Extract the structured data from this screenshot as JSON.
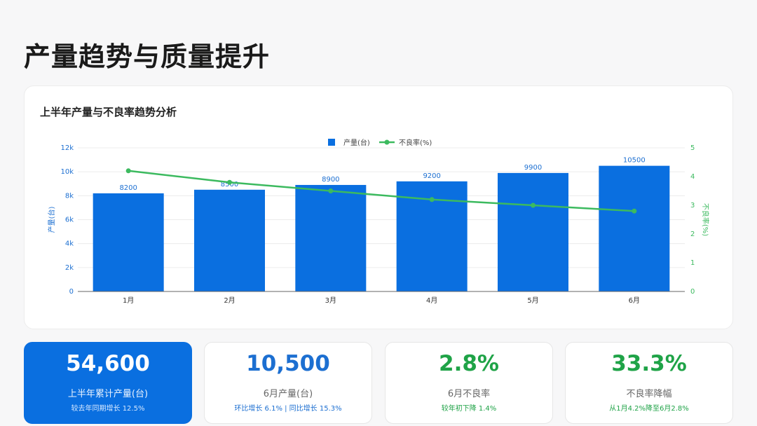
{
  "page_title": "产量趋势与质量提升",
  "chart_title": "上半年产量与不良率趋势分析",
  "chart_data": {
    "type": "bar",
    "categories": [
      "1月",
      "2月",
      "3月",
      "4月",
      "5月",
      "6月"
    ],
    "series": [
      {
        "name": "产量(台)",
        "type": "bar",
        "axis": "left",
        "values": [
          8200,
          8500,
          8900,
          9200,
          9900,
          10500
        ],
        "color": "#0a6fe0"
      },
      {
        "name": "不良率(%)",
        "type": "line",
        "axis": "right",
        "values": [
          4.2,
          3.8,
          3.5,
          3.2,
          3.0,
          2.8
        ],
        "color": "#3cba5f"
      }
    ],
    "bar_labels": [
      "8200",
      "8500",
      "8900",
      "9200",
      "9900",
      "10500"
    ],
    "ylabel": "产量(台)",
    "y2label": "不良率(%)",
    "ylim": [
      0,
      12000
    ],
    "y2lim": [
      0,
      5
    ],
    "yticks": [
      "0",
      "2k",
      "4k",
      "6k",
      "8k",
      "10k",
      "12k"
    ],
    "y2ticks": [
      "0",
      "1",
      "2",
      "3",
      "4",
      "5"
    ],
    "legend_position": "top-center",
    "grid": true
  },
  "kpis": [
    {
      "value": "54,600",
      "label": "上半年累计产量(台)",
      "sub": "较去年同期增长 12.5%",
      "value_color": "#ffffff",
      "sub_color": "#d6e8ff"
    },
    {
      "value": "10,500",
      "label": "6月产量(台)",
      "sub": "环比增长 6.1% | 同比增长 15.3%",
      "value_color": "#1c6fd1",
      "sub_color": "#1c6fd1"
    },
    {
      "value": "2.8%",
      "label": "6月不良率",
      "sub": "较年初下降 1.4%",
      "value_color": "#1fa347",
      "sub_color": "#1fa347"
    },
    {
      "value": "33.3%",
      "label": "不良率降幅",
      "sub": "从1月4.2%降至6月2.8%",
      "value_color": "#1fa347",
      "sub_color": "#1fa347"
    }
  ]
}
